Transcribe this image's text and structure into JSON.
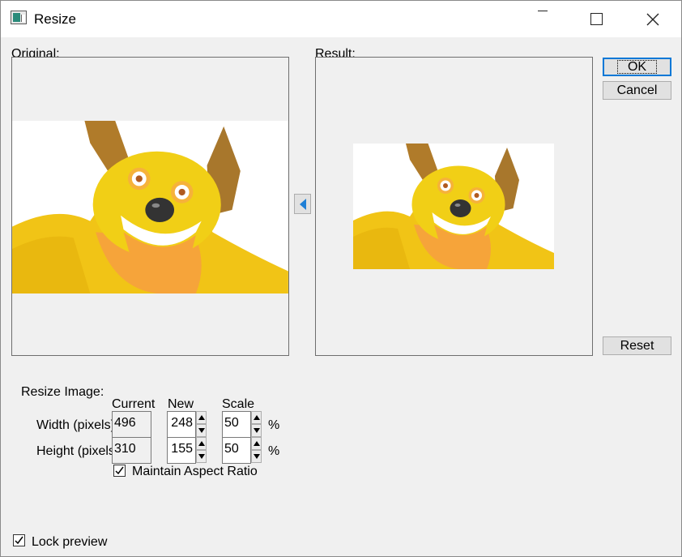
{
  "window": {
    "title": "Resize"
  },
  "labels": {
    "original": "Original:",
    "result": "Result:",
    "resize_image": "Resize Image:",
    "current": "Current",
    "new": "New",
    "scale": "Scale",
    "width": "Width (pixels)",
    "height": "Height (pixels)",
    "percent": "%"
  },
  "buttons": {
    "ok": "OK",
    "cancel": "Cancel",
    "reset": "Reset"
  },
  "fields": {
    "width_current": "496",
    "width_new": "248",
    "width_scale": "50",
    "height_current": "310",
    "height_new": "155",
    "height_scale": "50"
  },
  "checkboxes": {
    "maintain_aspect": {
      "label": "Maintain Aspect Ratio",
      "checked": true
    },
    "lock_preview": {
      "label": "Lock preview",
      "checked": true
    }
  },
  "icons": {
    "app": "app-icon",
    "minimize": "minimize-icon",
    "maximize": "maximize-icon",
    "close": "close-icon",
    "transfer": "arrow-left-icon"
  },
  "colors": {
    "accent": "#0078d7",
    "arrow": "#1e7fd6"
  }
}
